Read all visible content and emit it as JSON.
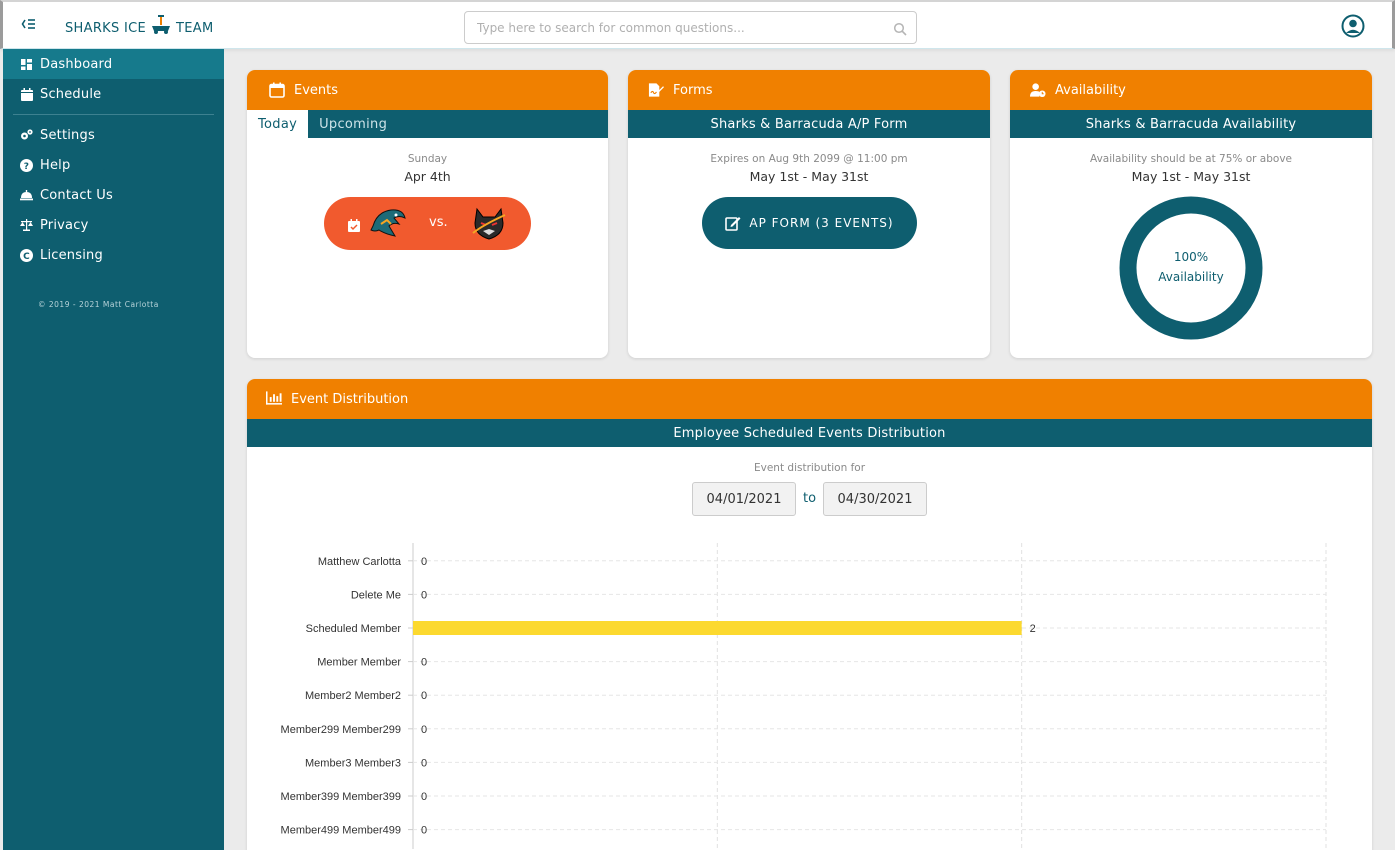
{
  "header": {
    "brand_left": "SHARKS ICE",
    "brand_right": "TEAM",
    "search_placeholder": "Type here to search for common questions..."
  },
  "sidebar": {
    "items": [
      {
        "label": "Dashboard",
        "icon": "dashboard-icon",
        "active": true
      },
      {
        "label": "Schedule",
        "icon": "calendar-icon"
      },
      {
        "label": "Settings",
        "icon": "gears-icon"
      },
      {
        "label": "Help",
        "icon": "question-icon"
      },
      {
        "label": "Contact Us",
        "icon": "bell-icon"
      },
      {
        "label": "Privacy",
        "icon": "balance-scale-icon"
      },
      {
        "label": "Licensing",
        "icon": "copyright-icon"
      }
    ],
    "copyright": "© 2019 - 2021 Matt Carlotta"
  },
  "events": {
    "title": "Events",
    "tabs": [
      "Today",
      "Upcoming"
    ],
    "day": "Sunday",
    "date": "Apr 4th",
    "vs": "vs."
  },
  "forms": {
    "title": "Forms",
    "subtitle": "Sharks & Barracuda A/P Form",
    "expires": "Expires on Aug 9th 2099 @ 11:00 pm",
    "range": "May 1st - May 31st",
    "button": "AP FORM (3 EVENTS)"
  },
  "availability": {
    "title": "Availability",
    "subtitle": "Sharks & Barracuda Availability",
    "note": "Availability should be at 75% or above",
    "range": "May 1st - May 31st",
    "percent": "100%",
    "label": "Availability",
    "value": 1.0
  },
  "distribution": {
    "title": "Event Distribution",
    "subtitle": "Employee Scheduled Events Distribution",
    "for_label": "Event distribution for",
    "start": "04/01/2021",
    "to": "to",
    "end": "04/30/2021"
  },
  "colors": {
    "teal": "#0e5e6f",
    "orange": "#f08000",
    "bar": "#fcd92f",
    "pill": "#f15a2e"
  },
  "chart_data": {
    "type": "bar",
    "orientation": "horizontal",
    "categories": [
      "Matthew Carlotta",
      "Delete Me",
      "Scheduled Member",
      "Member Member",
      "Member2 Member2",
      "Member299 Member299",
      "Member3 Member3",
      "Member399 Member399",
      "Member499 Member499"
    ],
    "values": [
      0,
      0,
      2,
      0,
      0,
      0,
      0,
      0,
      0
    ],
    "xlim": [
      0,
      3
    ],
    "grid": true
  }
}
